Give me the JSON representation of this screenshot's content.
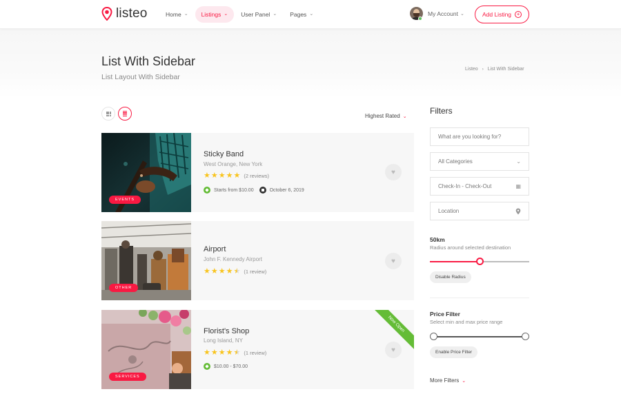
{
  "header": {
    "logo_text": "listeo",
    "nav": [
      {
        "label": "Home"
      },
      {
        "label": "Listings"
      },
      {
        "label": "User Panel"
      },
      {
        "label": "Pages"
      }
    ],
    "account_label": "My Account",
    "add_listing_label": "Add Listing"
  },
  "titlebar": {
    "title": "List With Sidebar",
    "subtitle": "List Layout With Sidebar",
    "breadcrumb": [
      "Listeo",
      "List With Sidebar"
    ]
  },
  "toolbar": {
    "sort_label": "Highest Rated",
    "view_mode": "list"
  },
  "listings": [
    {
      "title": "Sticky Band",
      "address": "West Orange, New York",
      "rating": 5,
      "reviews": "(2 reviews)",
      "tag": "EVENTS",
      "price": "Starts from $10.00",
      "date": "October 6, 2019"
    },
    {
      "title": "Airport",
      "address": "John F. Kennedy Airport",
      "rating": 4.5,
      "reviews": "(1 review)",
      "tag": "OTHER"
    },
    {
      "title": "Florist's Shop",
      "address": "Long Island, NY",
      "rating": 4.5,
      "reviews": "(1 review)",
      "tag": "SERVICES",
      "price": "$10.00 - $70.00",
      "badge": "Now Open"
    }
  ],
  "sidebar": {
    "title": "Filters",
    "search_placeholder": "What are you looking for?",
    "category_value": "All Categories",
    "dates_placeholder": "Check-In - Check-Out",
    "location_placeholder": "Location",
    "radius_value": "50km",
    "radius_desc": "Radius around selected destination",
    "radius_fraction": 0.5,
    "disable_radius_label": "Disable Radius",
    "price_title": "Price Filter",
    "price_desc": "Select min and max price range",
    "enable_price_label": "Enable Price Filter",
    "more_filters_label": "More Filters"
  },
  "colors": {
    "accent": "#f91942",
    "green": "#64bc36",
    "star": "#f8c41e"
  }
}
